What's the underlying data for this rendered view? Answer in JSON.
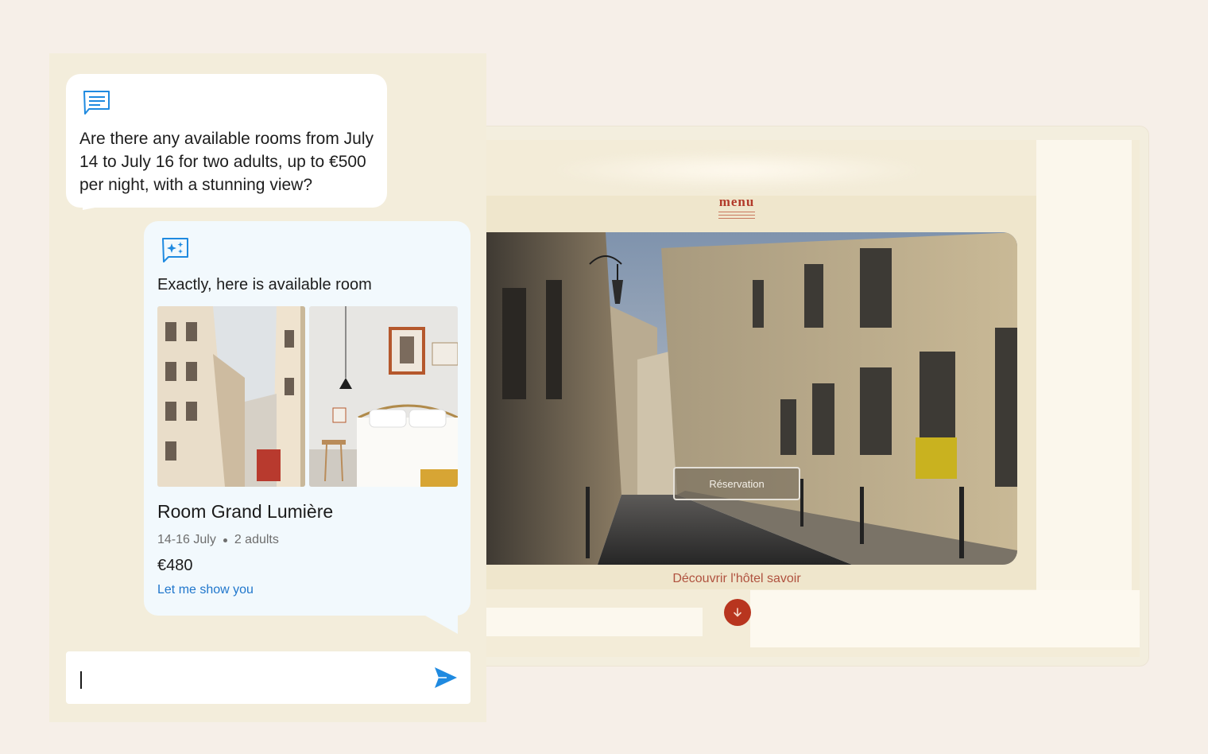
{
  "chat": {
    "user_message": "Are there any available rooms from July 14 to July 16 for two adults, up to €500 per night, with a stunning view?",
    "ai_heading": "Exactly, here is available room",
    "room": {
      "title": "Room Grand Lumière",
      "dates": "14-16 July",
      "guests": "2 adults",
      "price": "€480",
      "link": "Let me show you"
    },
    "input": {
      "value": "",
      "placeholder": ""
    },
    "icons": {
      "user": "message-icon",
      "ai": "sparkle-message-icon",
      "send": "send-icon"
    }
  },
  "website": {
    "menu_label": "menu",
    "reservation_label": "Réservation",
    "discover_text": "Découvrir l'hôtel savoir",
    "scroll_icon": "arrow-down-icon"
  },
  "colors": {
    "page_background": "#f6efe8",
    "chat_panel": "#f3eddb",
    "ai_bubble": "#f2f9fd",
    "accent_blue": "#1f8ae0",
    "hotel_red": "#b8351f"
  }
}
